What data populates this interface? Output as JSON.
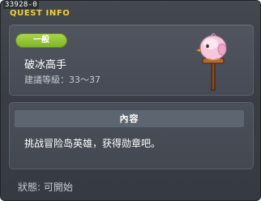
{
  "window": {
    "quest_id": "33928-0",
    "title": "QUEST INFO"
  },
  "quest": {
    "category_badge": "一般",
    "name": "破冰高手",
    "level_text": "建議等級：33～37",
    "npc_icon": "pink-bird-on-signpost-icon"
  },
  "content": {
    "header": "內容",
    "description": "挑战冒险岛英雄，获得勋章吧。"
  },
  "status": {
    "text": "狀態:  可開始"
  },
  "colors": {
    "title_yellow": "#f2d13a",
    "badge_green": "#8fc23a",
    "panel_bg": "#4a4f59",
    "content_header_bg": "#5d6670"
  }
}
